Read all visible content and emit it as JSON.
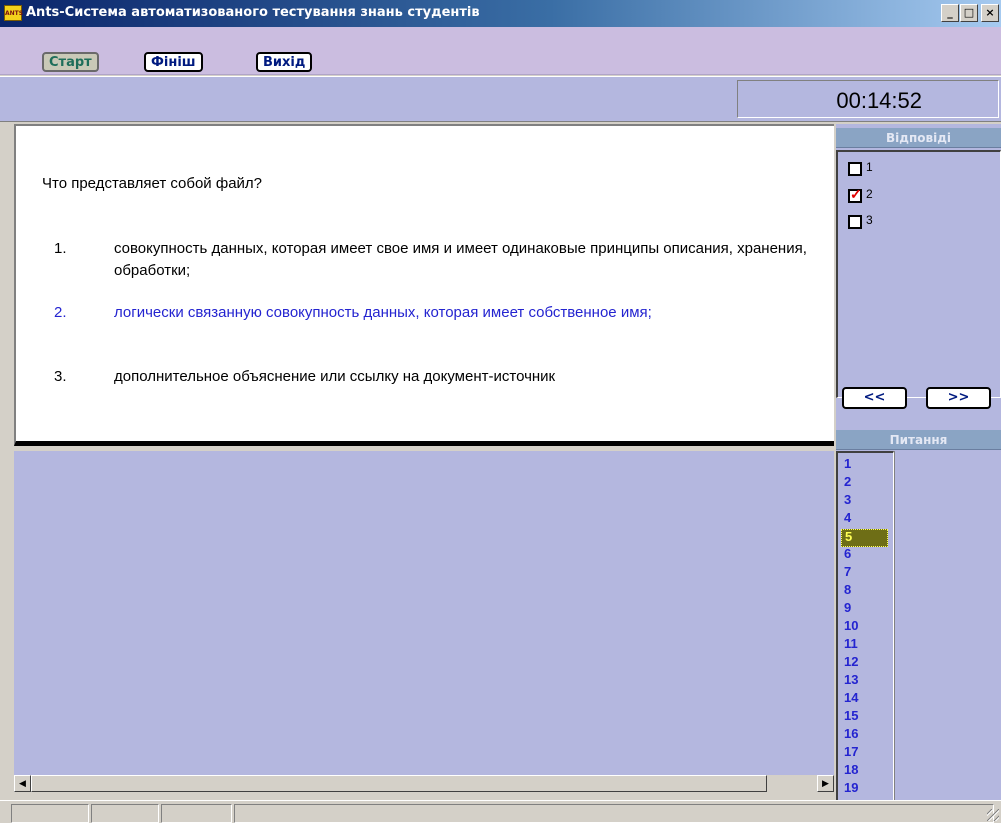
{
  "window": {
    "icon_label": "ANTS",
    "title": "Ants-Система автоматизованого тестування знань студентів",
    "min_label": "_",
    "max_label": "□",
    "close_label": "×"
  },
  "menu": {
    "start": "Старт",
    "finish": "Фініш",
    "exit": "Вихід"
  },
  "timer": "00:14:52",
  "question": {
    "text": "Что представляет собой файл?",
    "options": [
      {
        "num": "1.",
        "text": "совокупность данных, которая имеет свое имя и имеет одинаковые принципы описания, хранения, обработки;"
      },
      {
        "num": "2.",
        "text": "логически связанную совокупность данных, которая имеет собственное имя;"
      },
      {
        "num": "3.",
        "text": "дополнительное объяснение или ссылку на документ-источник"
      }
    ]
  },
  "answers": {
    "header": "Відповіді",
    "items": [
      {
        "label": "1",
        "checked": false
      },
      {
        "label": "2",
        "checked": true
      },
      {
        "label": "3",
        "checked": false
      }
    ],
    "prev": "<<",
    "next": ">>"
  },
  "questions": {
    "header": "Питання",
    "items": [
      "1",
      "2",
      "3",
      "4",
      "5",
      "6",
      "7",
      "8",
      "9",
      "10",
      "11",
      "12",
      "13",
      "14",
      "15",
      "16",
      "17",
      "18",
      "19"
    ],
    "active": "5"
  },
  "scroll": {
    "left": "◀",
    "right": "▶"
  },
  "colors": {
    "accent_blue": "#2424d0",
    "panel_bg": "#b4b7df",
    "menu_bg": "#cbbde0",
    "checkmark": "#e00000",
    "active_question_bg": "#6e6e16"
  }
}
